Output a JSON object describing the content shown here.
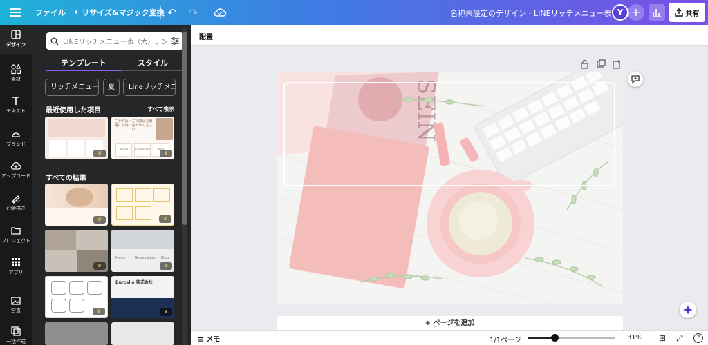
{
  "topbar": {
    "file_label": "ファイル",
    "resize_label": "リサイズ&マジック変換",
    "doc_title": "名称未設定のデザイン - LINEリッチメニュー表（大）",
    "avatar_initial": "Y",
    "add_label": "+",
    "share_label": "共有"
  },
  "rail": {
    "items": [
      {
        "label": "デザイン",
        "icon": "layout-icon"
      },
      {
        "label": "素材",
        "icon": "shapes-icon"
      },
      {
        "label": "テキスト",
        "icon": "text-icon"
      },
      {
        "label": "ブランド",
        "icon": "brand-icon"
      },
      {
        "label": "アップロード",
        "icon": "upload-icon"
      },
      {
        "label": "お絵描き",
        "icon": "draw-icon"
      },
      {
        "label": "プロジェクト",
        "icon": "folder-icon"
      },
      {
        "label": "アプリ",
        "icon": "apps-icon"
      },
      {
        "label": "写真",
        "icon": "photo-icon"
      },
      {
        "label": "一括作成",
        "icon": "bulk-icon"
      }
    ]
  },
  "panel": {
    "search_placeholder": "LINEリッチメニュー表（大）テンプレ",
    "tabs": [
      "テンプレート",
      "スタイル"
    ],
    "chips": [
      "リッチメニュー",
      "夏",
      "Lineリッチメニュー"
    ],
    "recent_title": "最近使用した項目",
    "see_all": "すべて表示",
    "results_title": "すべての結果",
    "recent_thumb2_text": "ご予約は・ご相談はお気軽にお問い合わせください",
    "thumb_labels": {
      "blog": "Blog",
      "menu": "Menu",
      "reservation": "Reservation",
      "profile": "Profile",
      "information": "Information",
      "company": "Burcelle 株式会社"
    }
  },
  "canvas": {
    "context_label": "配置",
    "add_page_label": "+ ページを追加"
  },
  "bottombar": {
    "notes_label": "メモ",
    "page_count": "1/1ページ",
    "zoom_label": "31%",
    "zoom_value": 31,
    "help": "?"
  },
  "colors": {
    "topbar_gradient_start": "#1fb2d8",
    "topbar_gradient_end": "#7a4fe6",
    "panel_bg": "#252627",
    "rail_bg": "#18191b",
    "tab_accent": "#8b5cf6"
  }
}
